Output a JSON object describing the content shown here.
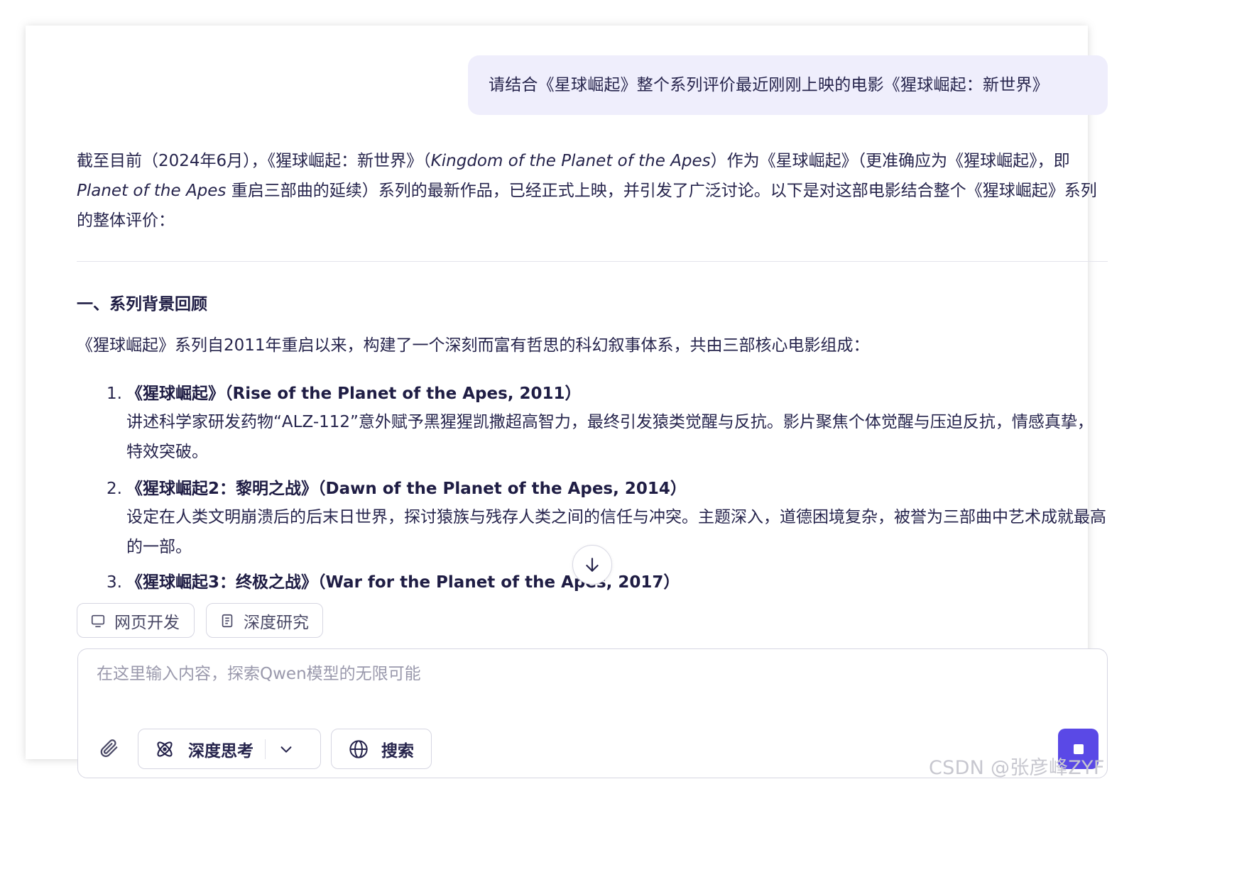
{
  "user_message": "请结合《星球崛起》整个系列评价最近刚刚上映的电影《猩球崛起：新世界》",
  "answer": {
    "intro": {
      "part1": "截至目前（2024年6月），《猩球崛起：新世界》（",
      "english_title": "Kingdom of the Planet of the Apes",
      "part2": "）作为《星球崛起》（更准确应为《猩球崛起》，即 ",
      "english_series": "Planet of the Apes",
      "part3": " 重启三部曲的延续）系列的最新作品，已经正式上映，并引发了广泛讨论。以下是对这部电影结合整个《猩球崛起》系列的整体评价："
    },
    "section_title": "一、系列背景回顾",
    "section_intro": "《猩球崛起》系列自2011年重启以来，构建了一个深刻而富有哲思的科幻叙事体系，共由三部核心电影组成：",
    "films": [
      {
        "num": "1.",
        "title": "《猩球崛起》（Rise of the Planet of the Apes, 2011）",
        "desc": "讲述科学家研发药物“ALZ-112”意外赋予黑猩猩凯撒超高智力，最终引发猿类觉醒与反抗。影片聚焦个体觉醒与压迫反抗，情感真挚，特效突破。"
      },
      {
        "num": "2.",
        "title": "《猩球崛起2：黎明之战》（Dawn of the Planet of the Apes, 2014）",
        "desc": "设定在人类文明崩溃后的后末日世界，探讨猿族与残存人类之间的信任与冲突。主题深入，道德困境复杂，被誉为三部曲中艺术成就最高的一部。"
      },
      {
        "num": "3.",
        "title": "《猩球崛起3：终极之战》（War for the Planet of the Apes, 2017）",
        "desc": ""
      }
    ]
  },
  "chips": {
    "web_dev": "网页开发",
    "deep_research": "深度研究"
  },
  "composer": {
    "placeholder": "在这里输入内容，探索Qwen模型的无限可能",
    "value": "",
    "deep_think_label": "深度思考",
    "search_label": "搜索"
  },
  "icons": {
    "scroll": "arrow-down-icon",
    "web_dev": "monitor-icon",
    "deep_research": "document-icon",
    "attach": "paperclip-icon",
    "deep_think": "atom-icon",
    "dropdown": "chevron-down-icon",
    "search": "globe-icon",
    "stop": "stop-icon"
  },
  "colors": {
    "accent": "#5a49e6",
    "user_bubble_bg": "#efeefc",
    "text": "#26244c"
  },
  "watermark": "CSDN @张彦峰ZYF"
}
